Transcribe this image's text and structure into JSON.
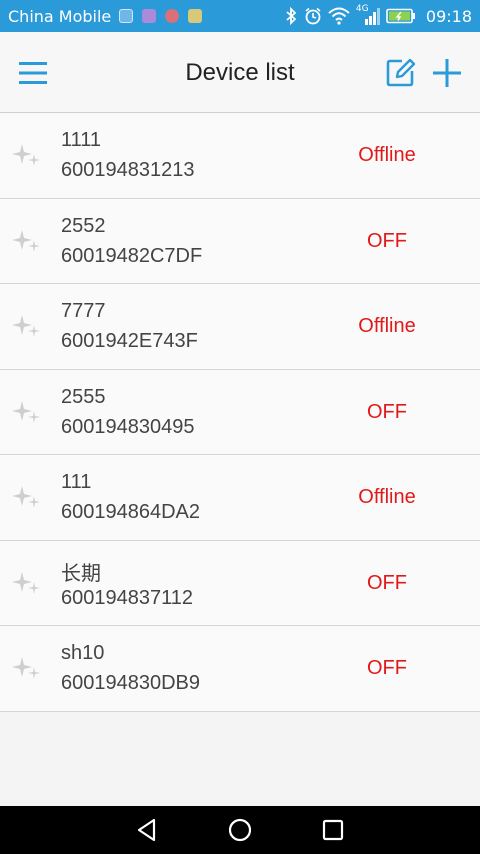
{
  "status_bar": {
    "carrier": "China Mobile",
    "network": "4G",
    "time": "09:18"
  },
  "header": {
    "title": "Device list",
    "accent_color": "#2a9bd8"
  },
  "devices": [
    {
      "name": "1111",
      "id": "600194831213",
      "status": "Offline"
    },
    {
      "name": "2552",
      "id": "60019482C7DF",
      "status": "OFF"
    },
    {
      "name": "7777",
      "id": "6001942E743F",
      "status": "Offline"
    },
    {
      "name": "2555",
      "id": "600194830495",
      "status": "OFF"
    },
    {
      "name": "111",
      "id": "600194864DA2",
      "status": "Offline"
    },
    {
      "name": "长期",
      "id": "600194837112",
      "status": "OFF"
    },
    {
      "name": "sh10",
      "id": "600194830DB9",
      "status": "OFF"
    }
  ],
  "colors": {
    "status_text": "#e01a1a",
    "status_bar_bg": "#2a9bd8"
  }
}
